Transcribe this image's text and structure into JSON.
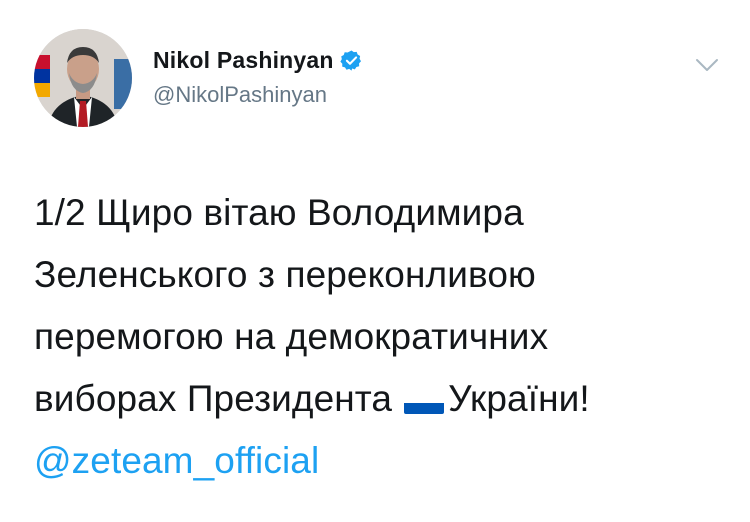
{
  "author": {
    "display_name": "Nikol Pashinyan",
    "handle": "@NikolPashinyan",
    "verified": true
  },
  "icons": {
    "verified": "verified-badge-icon",
    "caret": "chevron-down-icon",
    "flag": "ukraine-flag-icon"
  },
  "colors": {
    "link": "#1da1f2",
    "verified": "#1da1f2",
    "text": "#14171a",
    "secondary": "#657786",
    "flag_blue": "#0057b7",
    "flag_yellow": "#ffd700"
  },
  "tweet": {
    "line1": "1/2 Щиро вітаю Володимира",
    "line2": "Зеленського з переконливою",
    "line3": "перемогою на демократичних",
    "line4_before": "виборах Президента",
    "line4_after": "України!",
    "mention": "@zeteam_official"
  }
}
